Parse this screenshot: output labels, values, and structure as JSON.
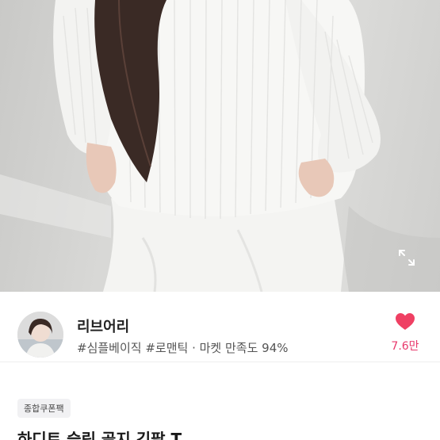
{
  "product_image": {
    "alt": "product-photo",
    "expand_icon": "expand-icon"
  },
  "shop": {
    "avatar_icon": "shop-avatar",
    "name": "리브어리",
    "tags": "#심플베이직 #로맨틱 · 마켓 만족도 94%",
    "like_icon": "heart-icon",
    "like_color": "#ef4063",
    "like_count": "7.6만"
  },
  "coupon": {
    "label": "종합쿠폰팩"
  },
  "product": {
    "title": "하디트 슬림 골지 긴팔 T"
  }
}
